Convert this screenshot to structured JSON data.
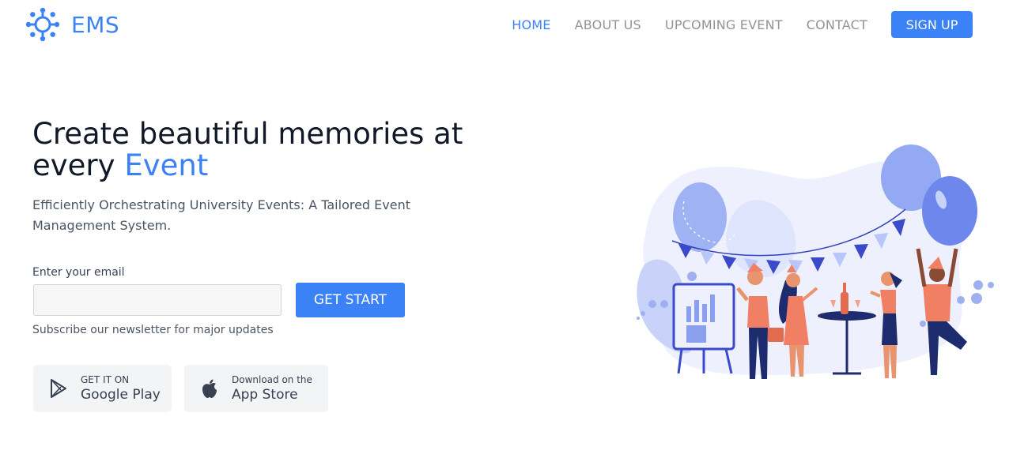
{
  "brand": {
    "name": "EMS"
  },
  "nav": {
    "items": [
      {
        "label": "HOME",
        "active": true
      },
      {
        "label": "ABOUT US",
        "active": false
      },
      {
        "label": "UPCOMING EVENT",
        "active": false
      },
      {
        "label": "CONTACT",
        "active": false
      }
    ],
    "signup_label": "SIGN UP"
  },
  "hero": {
    "title_prefix": "Create beautiful memories at every",
    "title_accent": "Event",
    "subtitle": "Efficiently Orchestrating University Events: A Tailored Event Management System."
  },
  "form": {
    "email_label": "Enter your email",
    "email_value": "",
    "email_placeholder": "",
    "submit_label": "GET START",
    "note": "Subscribe our newsletter for major updates"
  },
  "stores": {
    "google_play": {
      "small": "GET IT ON",
      "big": "Google Play",
      "icon": "play-store-icon"
    },
    "app_store": {
      "small": "Download on the",
      "big": "App Store",
      "icon": "apple-icon"
    }
  },
  "colors": {
    "accent": "#3b82f6",
    "text_dark": "#111827",
    "nav_muted": "#8f949b"
  }
}
